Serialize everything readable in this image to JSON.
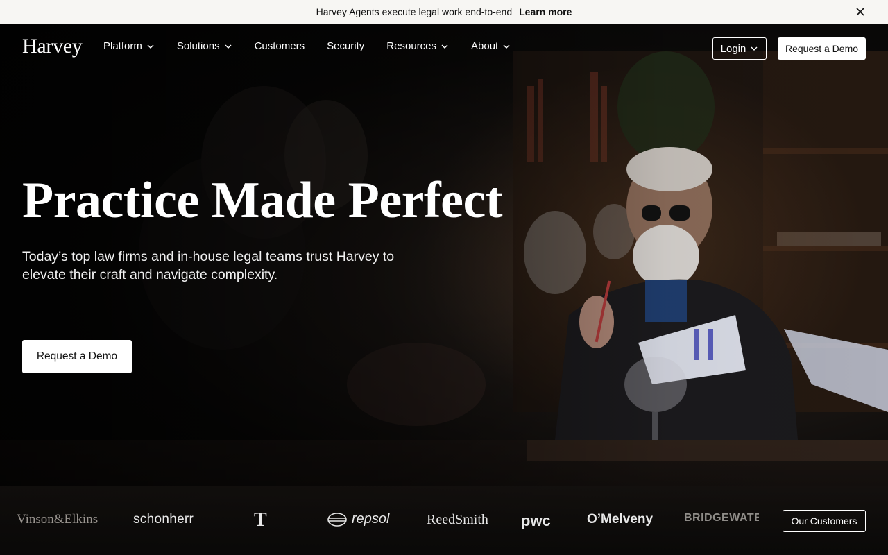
{
  "announcement": {
    "text": "Harvey Agents execute legal work end-to-end",
    "link_label": "Learn more",
    "close_icon": "close-icon"
  },
  "nav": {
    "logo": "Harvey",
    "items": [
      {
        "label": "Platform",
        "has_dropdown": true
      },
      {
        "label": "Solutions",
        "has_dropdown": true
      },
      {
        "label": "Customers",
        "has_dropdown": false
      },
      {
        "label": "Security",
        "has_dropdown": false
      },
      {
        "label": "Resources",
        "has_dropdown": true
      },
      {
        "label": "About",
        "has_dropdown": true
      }
    ],
    "login_label": "Login",
    "demo_label": "Request a Demo"
  },
  "hero": {
    "headline": "Practice Made Perfect",
    "subhead": "Today’s top law firms and in-house legal teams trust Harvey to elevate their craft and navigate complexity.",
    "cta_label": "Request a Demo"
  },
  "clients": {
    "logos": [
      "Vinson&Elkins",
      "schonherr",
      "T",
      "repsol",
      "ReedSmith",
      "pwc",
      "O’Melveny",
      "BRIDGEWATER"
    ],
    "button_label": "Our Customers"
  },
  "colors": {
    "announcement_bg": "#f7f6f3",
    "hero_bg": "#0a0908",
    "button_bg": "#ffffff",
    "text_primary": "#ffffff"
  }
}
